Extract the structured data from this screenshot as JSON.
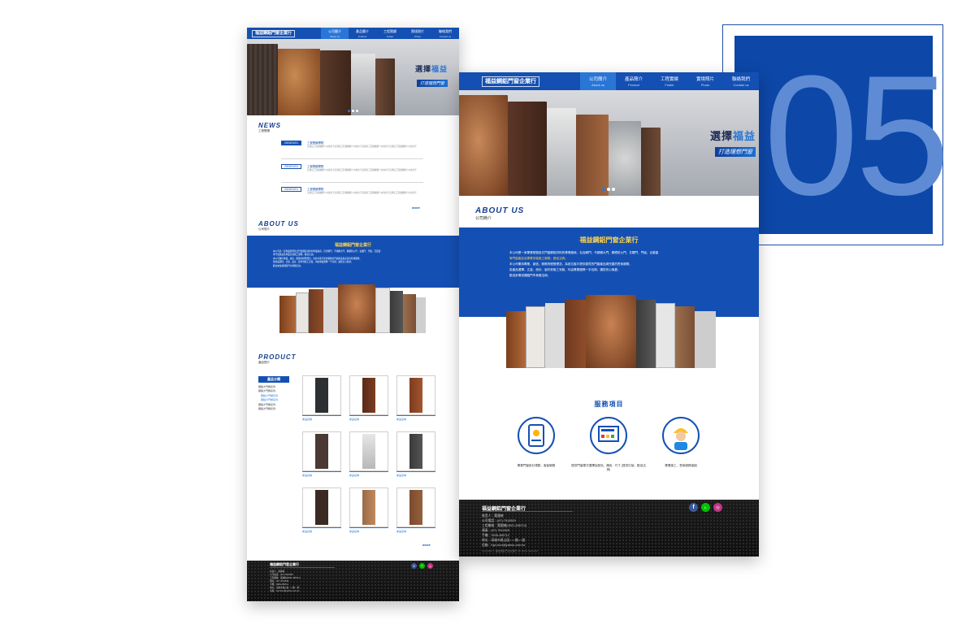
{
  "deco": {
    "number": "05"
  },
  "brand": "福益鋼鋁門窗企業行",
  "nav": [
    {
      "label": "公司簡介",
      "sub": "About us"
    },
    {
      "label": "產品簡介",
      "sub": "Product"
    },
    {
      "label": "工程實績",
      "sub": "Folder"
    },
    {
      "label": "實境照片",
      "sub": "Photo"
    },
    {
      "label": "聯絡我們",
      "sub": "Contact us"
    }
  ],
  "hero": {
    "title_a": "選擇",
    "title_b": "福益",
    "subtitle": "打造理想門窗"
  },
  "news": {
    "en": "NEWS",
    "zh": "工程實績",
    "items": [
      {
        "date": "2019/01/01",
        "title": "工程實績標題",
        "desc": "這裡是工程實績簡介內容文字這裡是工程實績簡介內容文字這裡是工程實績簡介內容文字這裡是工程實績簡介內容文字"
      },
      {
        "date": "2019/01/01",
        "title": "工程實績標題",
        "desc": "這裡是工程實績簡介內容文字這裡是工程實績簡介內容文字這裡是工程實績簡介內容文字這裡是工程實績簡介內容文字"
      },
      {
        "date": "2019/01/01",
        "title": "工程實績標題",
        "desc": "這裡是工程實績簡介內容文字這裡是工程實績簡介內容文字這裡是工程實績簡介內容文字這裡是工程實績簡介內容文字"
      }
    ],
    "more": "more"
  },
  "about": {
    "en": "ABOUT US",
    "zh": "公司簡介",
    "title": "福益鋼鋁門窗企業行",
    "lines": [
      "本公司是一家專業經營各式門窗鋼鋁材料的專業廠商，包含鋼門、不銹鋼大門、鋼鐵防火門、玄關門、門組，百葉窗",
      "等門窗產品及專業安裝施工服務，歡迎洽詢。",
      "本公司秉持專業、誠信、服務的經營理念，為各位客戶提供優質的門窗產品與完善的售後服務，",
      "從產品選擇、丈量、設計、製作到施工安裝，均由專業團隊一手包辦，讓您安心無憂。",
      "歡迎來電或親臨門市參觀洽詢。"
    ]
  },
  "product": {
    "en": "PRODUCT",
    "zh": "產品簡介",
    "cat_head": "產品分類",
    "categories": [
      {
        "label": "鋼製大門類系列",
        "sub": false
      },
      {
        "label": "鋼製大門類系列",
        "sub": false
      },
      {
        "label": "鋼製大門類系列",
        "sub": true
      },
      {
        "label": "鋼製大門類系列",
        "sub": true
      },
      {
        "label": "鋼製大門類系列",
        "sub": false
      },
      {
        "label": "鋼製大門類系列",
        "sub": false
      }
    ],
    "item_label": "產品名稱",
    "more": "more"
  },
  "services": {
    "title": "服務項目",
    "items": [
      {
        "caption": "專業門窗設計規劃，客製服務"
      },
      {
        "caption": "提供門窗樣式選擇及配色，顏色 · 尺寸 (提供訂製，歡迎洽詢)"
      },
      {
        "caption": "專業施工，售後服務保固"
      }
    ]
  },
  "footer": {
    "name": "福益鋼鋁門窗企業行",
    "lines": [
      "負責人：黃國禎",
      "公司電話：(07) 7012529",
      "工程聯絡：黃國禎(0921-456712)",
      "傳真：(07) 7012529",
      "手機：0928-456712",
      "地址：高雄市鳳山區○○○路○○號",
      "信箱：fuyi.door@yahoo.com.tw"
    ],
    "copyright": "Copyright © 福益鋼鋁門窗企業行 All rights reserved."
  }
}
